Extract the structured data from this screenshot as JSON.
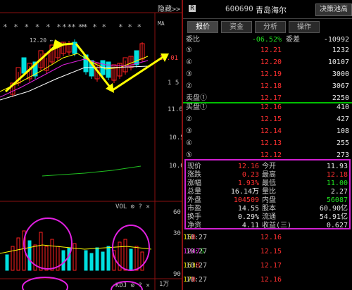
{
  "chart": {
    "hide_label": "隐藏>>",
    "star_row_1": "* * * * * * * *",
    "star_row_2": "* * *",
    "star_row_3": "* * *",
    "star_row_4": "* * *",
    "annotation_high": "12.20",
    "price_axis": [
      "12.01",
      "1 5",
      "11.0",
      "10.5",
      "10.0"
    ],
    "vol_label": "VOL",
    "vol_axis": [
      "60",
      "30",
      "1万"
    ],
    "kd_label": "KDJ",
    "kd_axis": [
      "90",
      "90"
    ],
    "ma_label": "MA",
    "colors": {
      "up": "#ff2020",
      "down": "#00e0e0",
      "annotation": "#ffff00",
      "circle": "#e020e0"
    }
  },
  "header": {
    "badge": "R",
    "code": "600690",
    "name": "青岛海尔",
    "decision_button": "决策池高"
  },
  "tabs": [
    "报价",
    "资金",
    "分析",
    "操作"
  ],
  "summary": {
    "label_1": "委比",
    "value_1": "-06.52%",
    "label_2": "委差",
    "value_2": "-10992"
  },
  "sell": [
    {
      "label": "⑤",
      "price": "12.21",
      "vol": "1232"
    },
    {
      "label": "④",
      "price": "12.20",
      "vol": "10107"
    },
    {
      "label": "③",
      "price": "12.19",
      "vol": "3000"
    },
    {
      "label": "②",
      "price": "12.18",
      "vol": "3067"
    },
    {
      "label": "卖盘①",
      "price": "12.17",
      "vol": "2250"
    }
  ],
  "buy": [
    {
      "label": "买盘①",
      "price": "12.16",
      "vol": "410"
    },
    {
      "label": "②",
      "price": "12.15",
      "vol": "427"
    },
    {
      "label": "③",
      "price": "12.14",
      "vol": "108"
    },
    {
      "label": "④",
      "price": "12.13",
      "vol": "255"
    },
    {
      "label": "⑤",
      "price": "12.12",
      "vol": "273"
    }
  ],
  "stats": [
    {
      "l1": "现价",
      "v1": "12.16",
      "l2": "今开",
      "v2": "11.93"
    },
    {
      "l1": "涨跌",
      "v1": "0.23",
      "l2": "最高",
      "v2": "12.18"
    },
    {
      "l1": "涨幅",
      "v1": "1.93%",
      "l2": "最低",
      "v2": "11.00"
    },
    {
      "l1": "总量",
      "v1": "16.14万",
      "l2": "量比",
      "v2": "2.27"
    },
    {
      "l1": "外盘",
      "v1": "104509",
      "l2": "内盘",
      "v2": "56087"
    },
    {
      "l1": "市盈",
      "v1": "14.55",
      "l2": "股本",
      "v2": "60.90亿"
    },
    {
      "l1": "换手",
      "v1": "0.29%",
      "l2": "流通",
      "v2": "54.91亿"
    },
    {
      "l1": "净资",
      "v1": "4.11",
      "l2": "收益(三)",
      "v2": "0.627"
    }
  ],
  "trades": [
    {
      "time": "10:27",
      "price": "12.16",
      "vol": "15",
      "flag": "B"
    },
    {
      "time": "10:27",
      "price": "12.15",
      "vol": "1247",
      "flag": "S"
    },
    {
      "time": "10:27",
      "price": "12.17",
      "vol": "163",
      "flag": "B"
    },
    {
      "time": "10:27",
      "price": "12.16",
      "vol": "17",
      "flag": "B"
    }
  ]
}
